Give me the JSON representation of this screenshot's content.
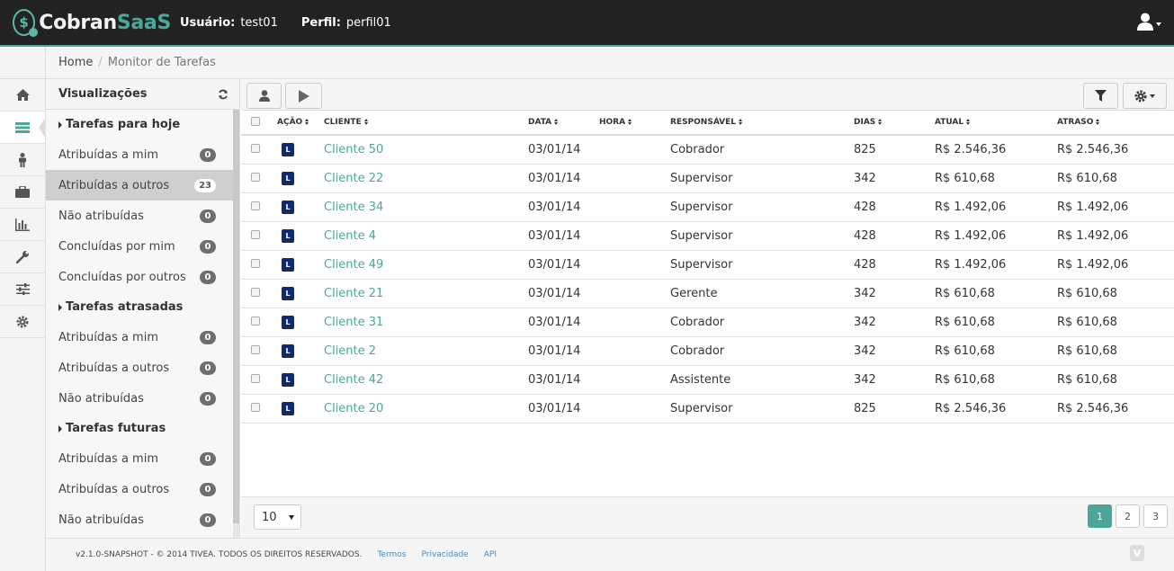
{
  "header": {
    "logo_part1": "Cobran",
    "logo_part2": "SaaS",
    "logo_symbol": "$",
    "user_label": "Usuário:",
    "user_value": "test01",
    "profile_label": "Perfil:",
    "profile_value": "perfil01",
    "accent_color": "#4ca699"
  },
  "rail": {
    "items": [
      {
        "icon": "home-icon"
      },
      {
        "icon": "list-icon",
        "active": true
      },
      {
        "icon": "person-icon"
      },
      {
        "icon": "briefcase-icon"
      },
      {
        "icon": "bar-chart-icon"
      },
      {
        "icon": "wrench-icon"
      },
      {
        "icon": "sliders-icon"
      },
      {
        "icon": "gear-icon"
      }
    ]
  },
  "breadcrumb": {
    "home": "Home",
    "current": "Monitor de Tarefas"
  },
  "views": {
    "title": "Visualizações",
    "groups": [
      {
        "title": "Tarefas para hoje",
        "items": [
          {
            "label": "Atribuídas a mim",
            "count": "0"
          },
          {
            "label": "Atribuídas a outros",
            "count": "23",
            "selected": true
          },
          {
            "label": "Não atribuídas",
            "count": "0"
          },
          {
            "label": "Concluídas por mim",
            "count": "0"
          },
          {
            "label": "Concluídas por outros",
            "count": "0"
          }
        ]
      },
      {
        "title": "Tarefas atrasadas",
        "items": [
          {
            "label": "Atribuídas a mim",
            "count": "0"
          },
          {
            "label": "Atribuídas a outros",
            "count": "0"
          },
          {
            "label": "Não atribuídas",
            "count": "0"
          }
        ]
      },
      {
        "title": "Tarefas futuras",
        "items": [
          {
            "label": "Atribuídas a mim",
            "count": "0"
          },
          {
            "label": "Atribuídas a outros",
            "count": "0"
          },
          {
            "label": "Não atribuídas",
            "count": "0"
          }
        ]
      }
    ]
  },
  "table": {
    "columns": [
      "Ação",
      "Cliente",
      "Data",
      "Hora",
      "Responsável",
      "Dias",
      "Atual",
      "Atraso"
    ],
    "action_badge": "L",
    "rows": [
      {
        "cliente": "Cliente 50",
        "data": "03/01/14",
        "hora": "",
        "responsavel": "Cobrador",
        "dias": "825",
        "atual": "R$ 2.546,36",
        "atraso": "R$ 2.546,36"
      },
      {
        "cliente": "Cliente 22",
        "data": "03/01/14",
        "hora": "",
        "responsavel": "Supervisor",
        "dias": "342",
        "atual": "R$ 610,68",
        "atraso": "R$ 610,68"
      },
      {
        "cliente": "Cliente 34",
        "data": "03/01/14",
        "hora": "",
        "responsavel": "Supervisor",
        "dias": "428",
        "atual": "R$ 1.492,06",
        "atraso": "R$ 1.492,06"
      },
      {
        "cliente": "Cliente 4",
        "data": "03/01/14",
        "hora": "",
        "responsavel": "Supervisor",
        "dias": "428",
        "atual": "R$ 1.492,06",
        "atraso": "R$ 1.492,06"
      },
      {
        "cliente": "Cliente 49",
        "data": "03/01/14",
        "hora": "",
        "responsavel": "Supervisor",
        "dias": "428",
        "atual": "R$ 1.492,06",
        "atraso": "R$ 1.492,06"
      },
      {
        "cliente": "Cliente 21",
        "data": "03/01/14",
        "hora": "",
        "responsavel": "Gerente",
        "dias": "342",
        "atual": "R$ 610,68",
        "atraso": "R$ 610,68"
      },
      {
        "cliente": "Cliente 31",
        "data": "03/01/14",
        "hora": "",
        "responsavel": "Cobrador",
        "dias": "342",
        "atual": "R$ 610,68",
        "atraso": "R$ 610,68"
      },
      {
        "cliente": "Cliente 2",
        "data": "03/01/14",
        "hora": "",
        "responsavel": "Cobrador",
        "dias": "342",
        "atual": "R$ 610,68",
        "atraso": "R$ 610,68"
      },
      {
        "cliente": "Cliente 42",
        "data": "03/01/14",
        "hora": "",
        "responsavel": "Assistente",
        "dias": "342",
        "atual": "R$ 610,68",
        "atraso": "R$ 610,68"
      },
      {
        "cliente": "Cliente 20",
        "data": "03/01/14",
        "hora": "",
        "responsavel": "Supervisor",
        "dias": "825",
        "atual": "R$ 2.546,36",
        "atraso": "R$ 2.546,36"
      }
    ]
  },
  "pagination": {
    "page_size": "10",
    "pages": [
      "1",
      "2",
      "3"
    ],
    "current_page": "1"
  },
  "footer": {
    "copyright": "v2.1.0-SNAPSHOT - © 2014 TIVEA. TODOS OS DIREITOS RESERVADOS.",
    "links": [
      "Termos",
      "Privacidade",
      "API"
    ],
    "logo_symbol": "V"
  }
}
